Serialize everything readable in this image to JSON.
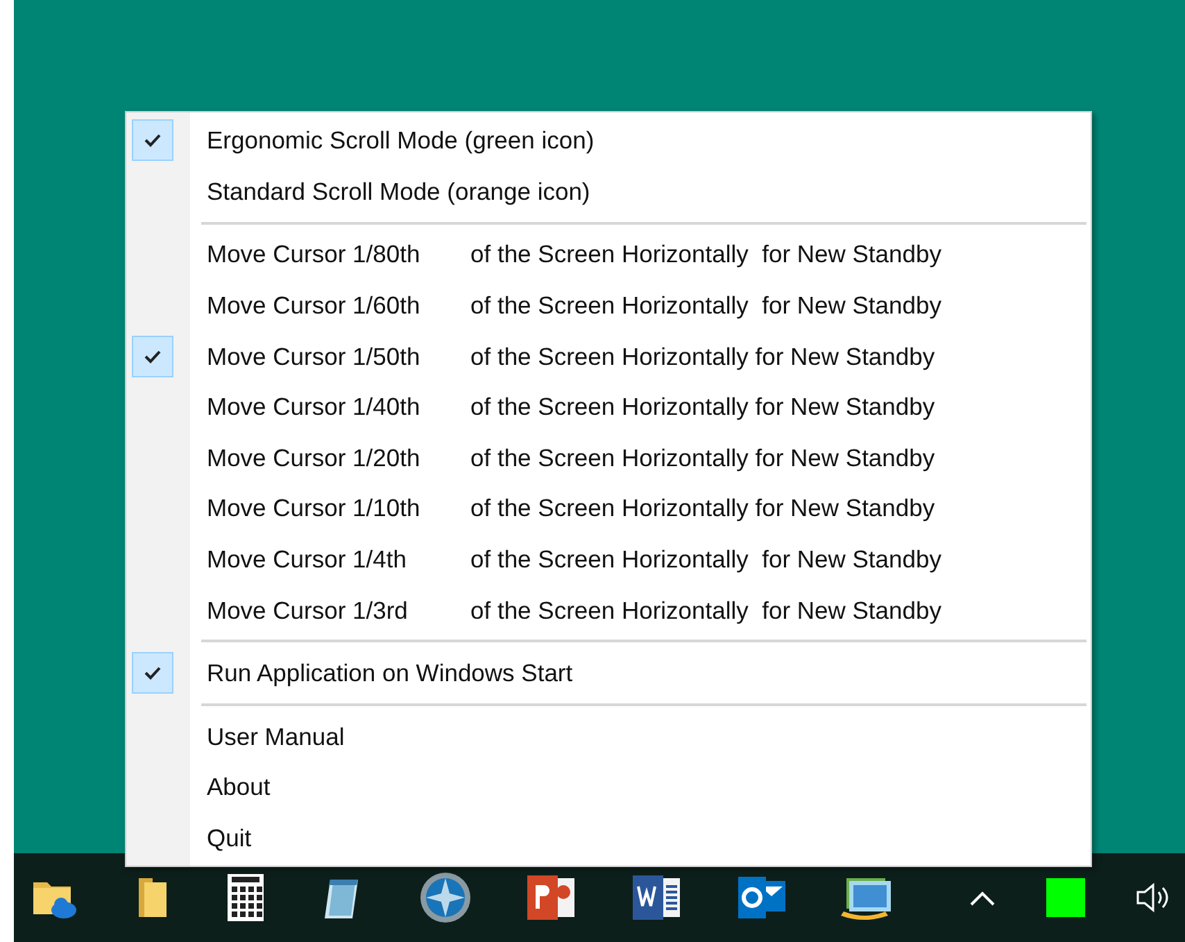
{
  "menu": {
    "groups": [
      [
        {
          "label": "Ergonomic Scroll Mode (green icon)",
          "checked": true
        },
        {
          "label": "Standard Scroll Mode (orange icon)",
          "checked": false
        }
      ],
      [
        {
          "label": "Move Cursor 1/80th",
          "detail": "of the Screen Horizontally  for New Standby",
          "checked": false
        },
        {
          "label": "Move Cursor 1/60th",
          "detail": "of the Screen Horizontally  for New Standby",
          "checked": false
        },
        {
          "label": "Move Cursor 1/50th",
          "detail": "of the Screen Horizontally for New Standby",
          "checked": true
        },
        {
          "label": "Move Cursor 1/40th",
          "detail": "of the Screen Horizontally for New Standby",
          "checked": false
        },
        {
          "label": "Move Cursor 1/20th",
          "detail": "of the Screen Horizontally for New Standby",
          "checked": false
        },
        {
          "label": "Move Cursor 1/10th",
          "detail": "of the Screen Horizontally for New Standby",
          "checked": false
        },
        {
          "label": "Move Cursor 1/4th",
          "detail": "of the Screen Horizontally  for New Standby",
          "checked": false
        },
        {
          "label": "Move Cursor 1/3rd",
          "detail": "of the Screen Horizontally  for New Standby",
          "checked": false
        }
      ],
      [
        {
          "label": "Run Application on Windows Start",
          "checked": true
        }
      ],
      [
        {
          "label": "User Manual",
          "checked": false
        },
        {
          "label": "About",
          "checked": false
        },
        {
          "label": "Quit",
          "checked": false
        }
      ]
    ]
  }
}
